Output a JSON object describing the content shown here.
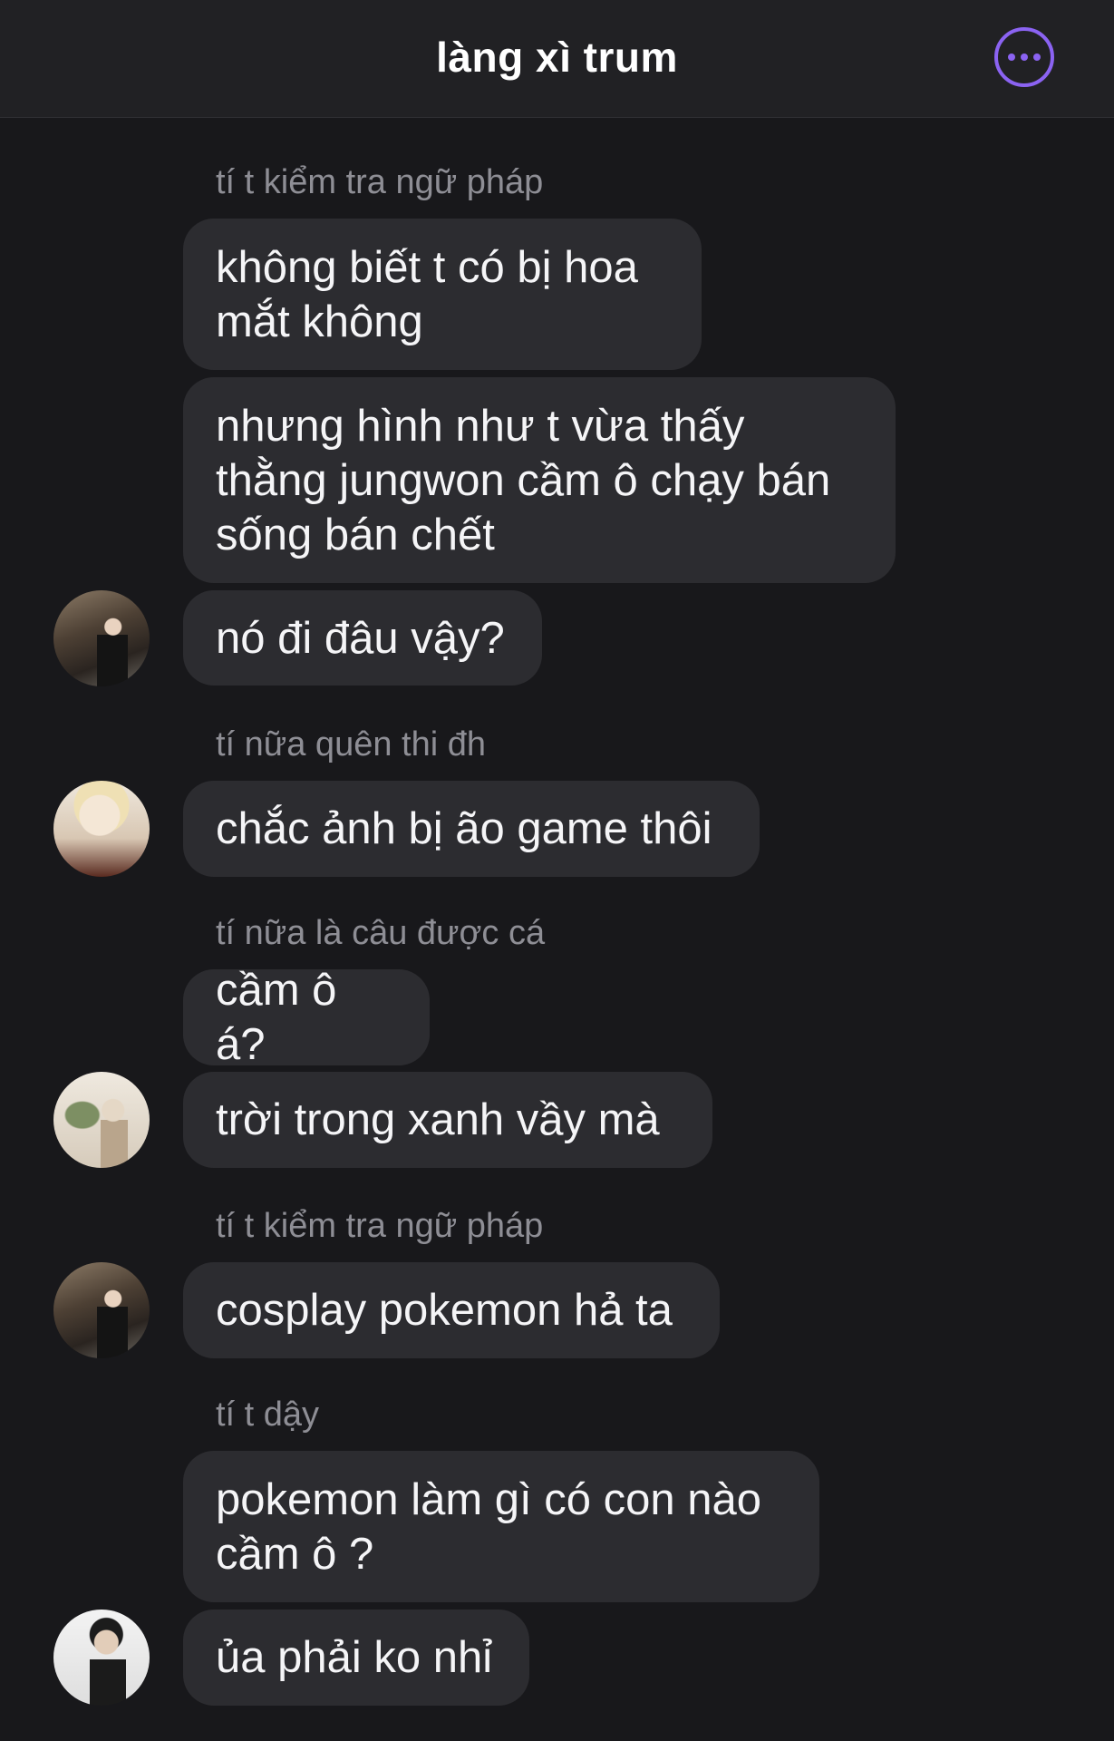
{
  "header": {
    "title": "làng xì trum",
    "more_icon": "more-horizontal-icon",
    "accent": "#8b63f2"
  },
  "messages": {
    "g1": {
      "sender": "tí t kiểm tra ngữ pháp",
      "m1": "không biết t có bị hoa\nmắt không",
      "m2": "nhưng hình như t vừa thấy\nthằng jungwon cầm ô chạy bán\nsống bán chết",
      "m3": "nó đi đâu vậy?"
    },
    "g2": {
      "sender": "tí nữa quên thi đh",
      "m1": "chắc ảnh bị ão game thôi"
    },
    "g3": {
      "sender": "tí nữa là câu được cá",
      "m1": "cầm ô á?",
      "m2": "trời trong xanh vầy mà"
    },
    "g4": {
      "sender": "tí t kiểm tra ngữ pháp",
      "m1": "cosplay pokemon hả ta"
    },
    "g5": {
      "sender": "tí t dậy",
      "m1": "pokemon làm gì có con nào\ncầm ô ?",
      "m2": "ủa phải ko nhỉ"
    }
  }
}
